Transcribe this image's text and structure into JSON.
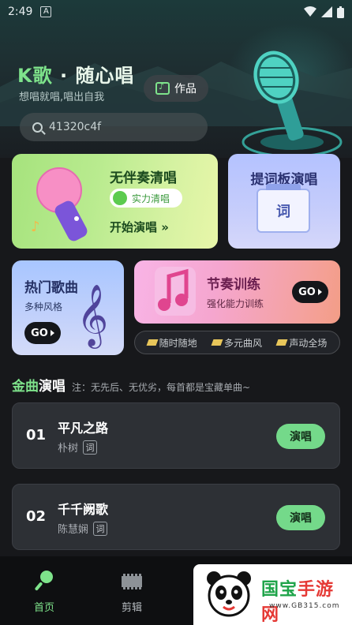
{
  "status_bar": {
    "time": "2:49",
    "notif_badge": "A"
  },
  "header": {
    "brand_k": "K歌",
    "brand_rest": " · 随心唱",
    "subtitle": "想唱就唱,唱出自我",
    "works_label": "作品",
    "search_value": "41320c4f"
  },
  "cards": {
    "acapella": {
      "title": "无伴奏清唱",
      "toggle_label": "实力清唱",
      "start_label": "开始演唱 »"
    },
    "prompter": {
      "title": "提词板演唱",
      "board_char": "词"
    },
    "hot": {
      "title": "热门歌曲",
      "subtitle": "多种风格",
      "go_label": "GO"
    },
    "rhythm": {
      "title": "节奏训练",
      "subtitle": "强化能力训练",
      "go_label": "GO"
    }
  },
  "tags": [
    "随时随地",
    "多元曲风",
    "声动全场"
  ],
  "section": {
    "title_a": "金曲",
    "title_b": "演唱",
    "note": "注：无先后、无优劣，每首都是宝藏单曲~"
  },
  "songs": [
    {
      "num": "01",
      "name": "平凡之路",
      "artist": "朴树",
      "lyric_badge": "词",
      "action": "演唱"
    },
    {
      "num": "02",
      "name": "千千阙歌",
      "artist": "陈慧娴",
      "lyric_badge": "词",
      "action": "演唱"
    }
  ],
  "nav": {
    "home": "首页",
    "edit": "剪辑"
  },
  "watermark": {
    "text_a": "国宝",
    "text_b": "手游网",
    "url": "www.GB315.com"
  },
  "colors": {
    "accent_green": "#7ee38b",
    "sing_button": "#74d98a",
    "background": "#17181b"
  }
}
